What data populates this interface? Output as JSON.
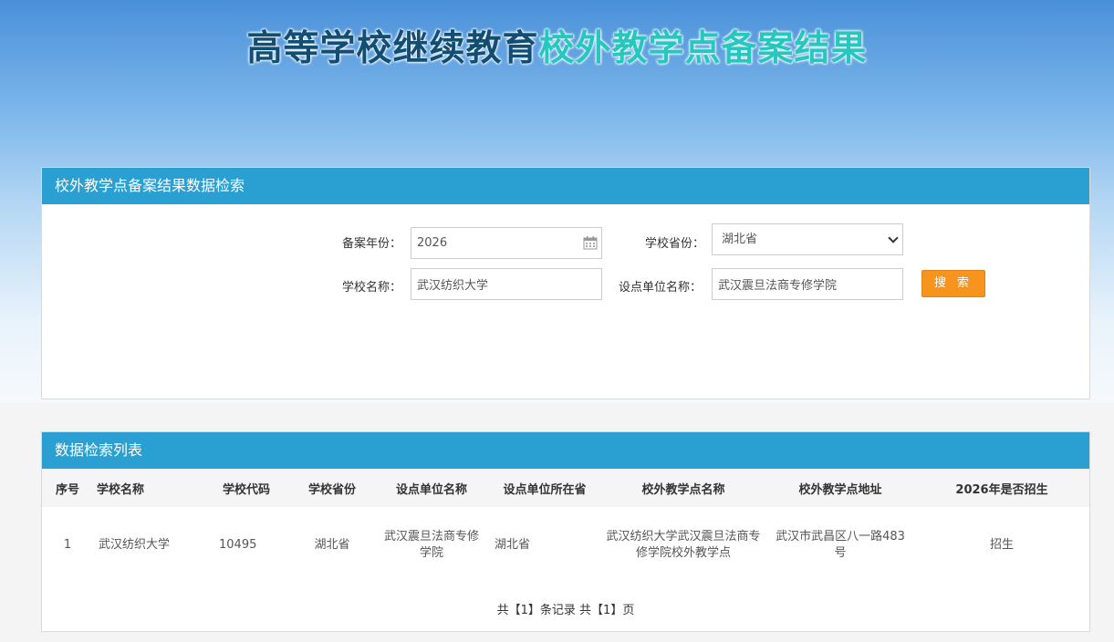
{
  "header": {
    "title_part1": "高等学校继续教育",
    "title_part2": "校外教学点备案结果"
  },
  "search_panel": {
    "title": "校外教学点备案结果数据检索",
    "year_label": "备案年份：",
    "year_value": "2026",
    "province_label": "学校省份：",
    "province_value": "湖北省",
    "school_label": "学校名称：",
    "school_value": "武汉纺织大学",
    "unit_label": "设点单位名称：",
    "unit_value": "武汉震旦法商专修学院",
    "search_button": "搜 索"
  },
  "list_panel": {
    "title": "数据检索列表",
    "columns": [
      "序号",
      "学校名称",
      "学校代码",
      "学校省份",
      "设点单位名称",
      "设点单位所在省",
      "校外教学点名称",
      "校外教学点地址",
      "2026年是否招生"
    ],
    "rows": [
      [
        "1",
        "武汉纺织大学",
        "10495",
        "湖北省",
        "武汉震旦法商专修学院",
        "湖北省",
        "武汉纺织大学武汉震旦法商专修学院校外教学点",
        "武汉市武昌区八一路483 号",
        "招生"
      ]
    ],
    "pager": "共【1】条记录 共【1】页"
  },
  "colors": {
    "panel_header": "#2a9fd1",
    "search_button": "#f7941d",
    "title_dark": "#124e73",
    "title_accent": "#27c7c0"
  }
}
